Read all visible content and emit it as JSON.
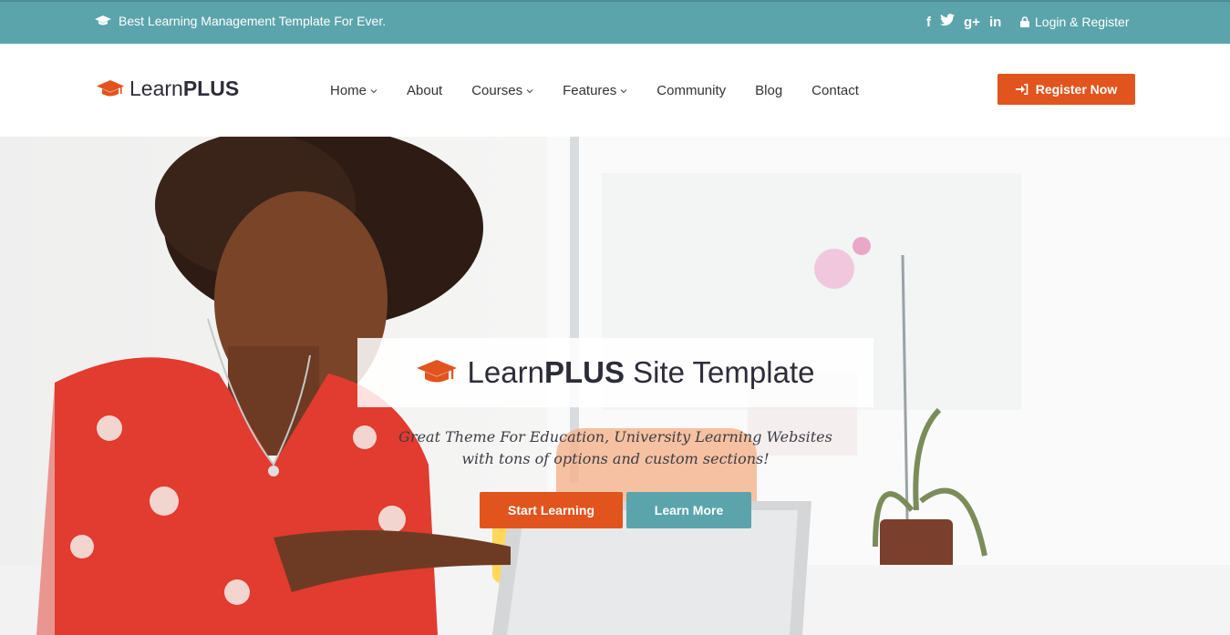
{
  "topbar": {
    "tagline": "Best Learning Management Template For Ever.",
    "social": [
      "f",
      "t",
      "g+",
      "in"
    ],
    "login": "Login & Register"
  },
  "header": {
    "logo_light": "Learn",
    "logo_bold": "PLUS",
    "nav": [
      {
        "label": "Home",
        "dropdown": true
      },
      {
        "label": "About",
        "dropdown": false
      },
      {
        "label": "Courses",
        "dropdown": true
      },
      {
        "label": "Features",
        "dropdown": true
      },
      {
        "label": "Community",
        "dropdown": false
      },
      {
        "label": "Blog",
        "dropdown": false
      },
      {
        "label": "Contact",
        "dropdown": false
      }
    ],
    "register": "Register Now"
  },
  "hero": {
    "title_light": "Learn",
    "title_bold": "PLUS",
    "title_rest": "Site Template",
    "subtitle_line1": "Great Theme For Education, University Learning Websites",
    "subtitle_line2": "with tons of options and custom sections!",
    "start_button": "Start Learning",
    "more_button": "Learn More"
  },
  "colors": {
    "topbar": "#5ba4ac",
    "accent_orange": "#e2541d",
    "accent_teal": "#5ba4ac",
    "text_dark": "#2d2d3a"
  }
}
